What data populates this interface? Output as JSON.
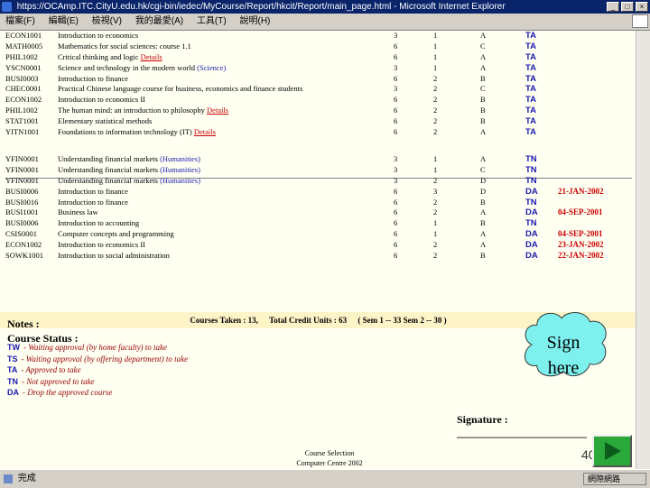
{
  "window": {
    "title": "https://OCAmp.ITC.CityU.edu.hk/cgi-bin/iedec/MyCourse/Report/hkcit/Report/main_page.html - Microsoft Internet Explorer",
    "buttons": [
      "_",
      "□",
      "×"
    ]
  },
  "menu": [
    "檔案(F)",
    "編輯(E)",
    "檢視(V)",
    "我的最愛(A)",
    "工具(T)",
    "說明(H)"
  ],
  "table_top": [
    {
      "code": "ECON1001",
      "title": "Introduction to economics",
      "units": "3",
      "sem": "1",
      "grade": "A",
      "status": "TA",
      "date": ""
    },
    {
      "code": "MATH0005",
      "title": "Mathematics for social sciences: course 1.1",
      "units": "6",
      "sem": "1",
      "grade": "C",
      "status": "TA",
      "date": ""
    },
    {
      "code": "PHIL1002",
      "title": "Critical thinking and logic",
      "link": "Details",
      "units": "6",
      "sem": "1",
      "grade": "A",
      "status": "TA",
      "date": ""
    },
    {
      "code": "YSCN0001",
      "title": "Science and technology in the modern world",
      "link": "(Science)",
      "units": "3",
      "sem": "1",
      "grade": "A",
      "status": "TA",
      "date": ""
    },
    {
      "code": "BUSI0003",
      "title": "Introduction to finance",
      "units": "6",
      "sem": "2",
      "grade": "B",
      "status": "TA",
      "date": ""
    },
    {
      "code": "CHEC0001",
      "title": "Practical Chinese language course for business, economics and finance students",
      "units": "3",
      "sem": "2",
      "grade": "C",
      "status": "TA",
      "date": ""
    },
    {
      "code": "ECON1002",
      "title": "Introduction to economics II",
      "units": "6",
      "sem": "2",
      "grade": "B",
      "status": "TA",
      "date": ""
    },
    {
      "code": "PHIL1002",
      "title": "The human mind: an introduction to philosophy",
      "link": "Details",
      "units": "6",
      "sem": "2",
      "grade": "B",
      "status": "TA",
      "date": ""
    },
    {
      "code": "STAT1001",
      "title": "Elementary statistical methods",
      "units": "6",
      "sem": "2",
      "grade": "B",
      "status": "TA",
      "date": ""
    },
    {
      "code": "YITN1001",
      "title": "Foundations to information technology (IT)",
      "link": "Details",
      "units": "6",
      "sem": "2",
      "grade": "A",
      "status": "TA",
      "date": ""
    }
  ],
  "table_bottom": [
    {
      "code": "YFIN0001",
      "title": "Understanding financial markets",
      "link": "(Humanities)",
      "units": "3",
      "sem": "1",
      "grade": "A",
      "status": "TN",
      "date": ""
    },
    {
      "code": "YFIN0001",
      "title": "Understanding financial markets",
      "link": "(Humanities)",
      "units": "3",
      "sem": "1",
      "grade": "C",
      "status": "TN",
      "date": ""
    },
    {
      "code": "YFIN0001",
      "title": "Understanding financial markets",
      "link": "(Humanities)",
      "units": "3",
      "sem": "2",
      "grade": "D",
      "status": "TN",
      "date": ""
    },
    {
      "code": "BUSI0006",
      "title": "Introduction to finance",
      "units": "6",
      "sem": "3",
      "grade": "D",
      "status": "DA",
      "date": "21-JAN-2002"
    },
    {
      "code": "BUSI0016",
      "title": "Introduction to finance",
      "units": "6",
      "sem": "2",
      "grade": "B",
      "status": "TN",
      "date": ""
    },
    {
      "code": "BUSI1001",
      "title": "Business law",
      "units": "6",
      "sem": "2",
      "grade": "A",
      "status": "DA",
      "date": "04-SEP-2001"
    },
    {
      "code": "BUSI0006",
      "title": "Introduction to accounting",
      "units": "6",
      "sem": "1",
      "grade": "B",
      "status": "TN",
      "date": ""
    },
    {
      "code": "CSIS0001",
      "title": "Computer concepts and programming",
      "units": "6",
      "sem": "1",
      "grade": "A",
      "status": "DA",
      "date": "04-SEP-2001"
    },
    {
      "code": "ECON1002",
      "title": "Introduction to economics II",
      "units": "6",
      "sem": "2",
      "grade": "A",
      "status": "DA",
      "date": "23-JAN-2002"
    },
    {
      "code": "SOWK1001",
      "title": "Introduction to social administration",
      "units": "6",
      "sem": "2",
      "grade": "B",
      "status": "DA",
      "date": "22-JAN-2002"
    }
  ],
  "summary": {
    "taken": "Courses Taken : 13,",
    "credits": "Total Credit Units : 63",
    "sems": "(    Sem 1 -- 33    Sem 2 -- 30    )"
  },
  "notes": {
    "heading": "Notes :",
    "status_heading": "Course Status :",
    "legend": [
      {
        "code": "TW",
        "text": "- Waiting approval (by home faculty) to take"
      },
      {
        "code": "TS",
        "text": "- Waiting approval (by offering department) to take"
      },
      {
        "code": "TA",
        "text": "- Approved to take"
      },
      {
        "code": "TN",
        "text": "- Not approved to take"
      },
      {
        "code": "DA",
        "text": "- Drop the approved course"
      }
    ]
  },
  "callout": {
    "line1": "Sign",
    "line2": "here"
  },
  "signature": "Signature : ________________________",
  "footer": {
    "line1": "Course Selection",
    "line2": "Computer Centre 2002"
  },
  "page_number": "40",
  "statusbar": {
    "text": "完成",
    "zone": "網際網路"
  },
  "colors": {
    "status_blue": "#1b1bb0",
    "date_red": "#cc0000",
    "summary_bg": "#fff4c8",
    "next_button": "#2aa83a"
  }
}
